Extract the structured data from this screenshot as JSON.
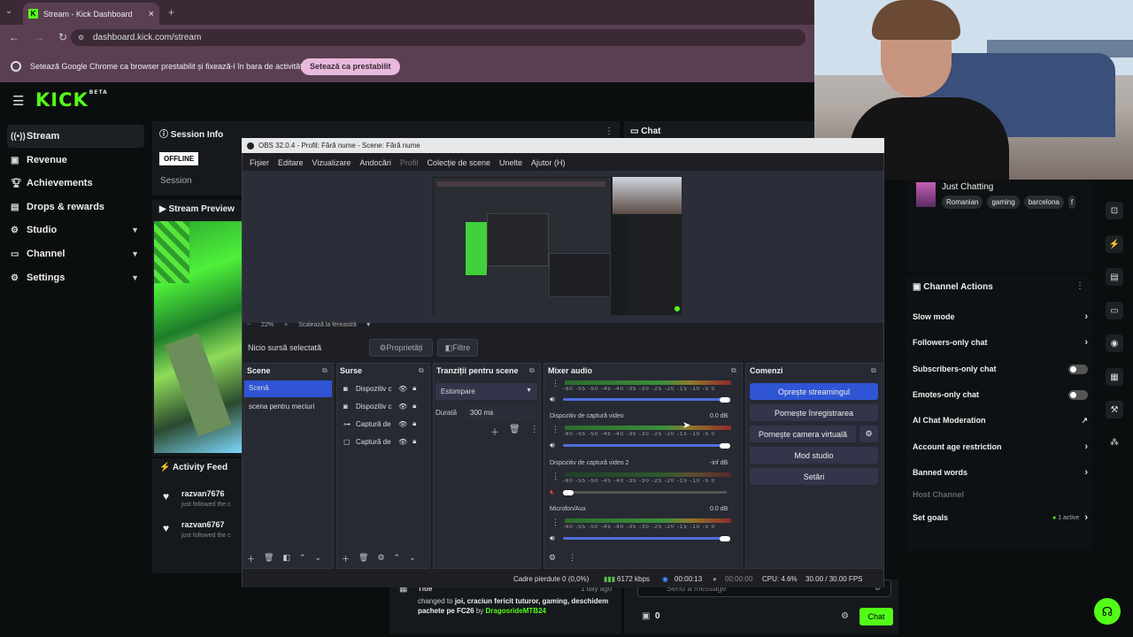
{
  "browser": {
    "tab_title": "Stream - Kick Dashboard",
    "url": "dashboard.kick.com/stream",
    "infobar_text": "Setează Google Chrome ca browser prestabilit și fixează-l în bara de activități",
    "infobar_button": "Setează ca prestabilit"
  },
  "kick": {
    "logo": "KICK",
    "logo_badge": "BETA",
    "sidebar": [
      {
        "label": "Stream",
        "icon": "stream-icon"
      },
      {
        "label": "Revenue",
        "icon": "revenue-icon"
      },
      {
        "label": "Achievements",
        "icon": "trophy-icon"
      },
      {
        "label": "Drops & rewards",
        "icon": "gift-icon"
      },
      {
        "label": "Studio",
        "icon": "gear-icon"
      },
      {
        "label": "Channel",
        "icon": "channel-icon"
      },
      {
        "label": "Settings",
        "icon": "gear-icon"
      }
    ],
    "session_info": {
      "title": "Session Info",
      "status": "OFFLINE",
      "label": "Session"
    },
    "chat": {
      "title": "Chat",
      "placeholder": "Send a message",
      "count": "0",
      "button": "Chat"
    },
    "stream_preview": {
      "title": "Stream Preview"
    },
    "activity_feed": {
      "title": "Activity Feed",
      "items": [
        {
          "user": "razvan7676",
          "text": "just followed the c"
        },
        {
          "user": "razvan6767",
          "text": "just followed the c"
        }
      ]
    },
    "title_change": {
      "label": "Title",
      "time": "1 day ago",
      "text_prefix": "changed to",
      "new_title": "joi, craciun fericit tuturor, gaming, deschidem pachete pe FC26",
      "by": "by",
      "author": "DragosrideMTB24"
    },
    "category": {
      "name": "Just Chatting",
      "tags": [
        "Romanian",
        "gaming",
        "barcelona",
        "f"
      ]
    },
    "channel_actions": {
      "title": "Channel Actions",
      "rows": [
        {
          "label": "Slow mode",
          "control": "chevron"
        },
        {
          "label": "Followers-only chat",
          "control": "chevron"
        },
        {
          "label": "Subscribers-only chat",
          "control": "toggle"
        },
        {
          "label": "Emotes-only chat",
          "control": "toggle"
        },
        {
          "label": "AI Chat Moderation",
          "control": "external"
        },
        {
          "label": "Account age restriction",
          "control": "chevron"
        },
        {
          "label": "Banned words",
          "control": "chevron"
        },
        {
          "label": "Host Channel",
          "control": "none"
        },
        {
          "label": "Set goals",
          "control": "chevron",
          "badge": "1 active"
        }
      ]
    }
  },
  "obs": {
    "title": "OBS 32.0.4 - Profil: Fără nume - Scene: Fără nume",
    "menu": [
      "Fișier",
      "Editare",
      "Vizualizare",
      "Andocări",
      "Profil",
      "Colecție de scene",
      "Unelte",
      "Ajutor (H)"
    ],
    "zoom": "22%",
    "scale_label": "Scalează la fereastră",
    "no_source": "Nicio sursă selectată",
    "properties": "Proprietăți",
    "filters": "Filtre",
    "scenes": {
      "title": "Scene",
      "items": [
        "Scenă",
        "scena pentru meciuri"
      ]
    },
    "sources": {
      "title": "Surse",
      "items": [
        "Dispozitiv c",
        "Dispozitiv c",
        "Captură de",
        "Captură de"
      ]
    },
    "transitions": {
      "title": "Tranziții pentru scene",
      "type": "Estompare",
      "duration_label": "Durată",
      "duration": "300 ms"
    },
    "mixer": {
      "title": "Mixer audio",
      "scale": "-60 -55 -50 -45 -40 -35 -30 -25 -20 -15 -10 -5 0",
      "channels": [
        {
          "name": "",
          "db": ""
        },
        {
          "name": "Dispozitiv de captură video",
          "db": "0.0 dB"
        },
        {
          "name": "Dispozitiv de captură video 2",
          "db": "-inf dB"
        },
        {
          "name": "Microfon/Aux",
          "db": "0.0 dB"
        }
      ]
    },
    "controls": {
      "title": "Comenzi",
      "buttons": [
        "Oprește streamingul",
        "Pornește înregistrarea",
        "Pornește camera virtuală",
        "Mod studio",
        "Setări"
      ]
    },
    "status": {
      "dropped": "Cadre pierdute 0 (0,0%)",
      "bitrate": "6172 kbps",
      "stream_time": "00:00:13",
      "rec_time": "00:00:00",
      "cpu": "CPU: 4.6%",
      "fps": "30.00 / 30.00 FPS"
    }
  },
  "colors": {
    "kick_green": "#53fc18",
    "obs_blue": "#2f55d4",
    "chrome_purple": "#5a3f52"
  }
}
